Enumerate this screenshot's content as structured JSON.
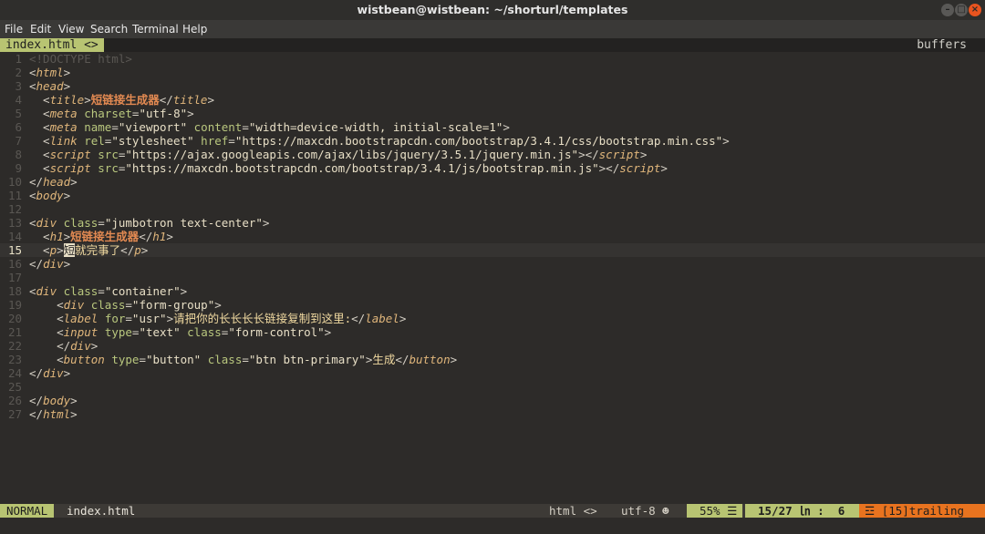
{
  "window": {
    "title": "wistbean@wistbean: ~/shorturl/templates"
  },
  "menu": [
    "File",
    "Edit",
    "View",
    "Search",
    "Terminal",
    "Help"
  ],
  "tabline": {
    "active_tab": "index.html",
    "active_tab_icon": "<>",
    "buffers_label": "buffers"
  },
  "editor": {
    "current_line": 15,
    "lines": [
      [
        [
          "c",
          "<!DOCTYPE html>"
        ]
      ],
      [
        [
          "b",
          "<"
        ],
        [
          "tag",
          "html"
        ],
        [
          "b",
          ">"
        ]
      ],
      [
        [
          "b",
          "<"
        ],
        [
          "tag",
          "head"
        ],
        [
          "b",
          ">"
        ]
      ],
      [
        [
          "b",
          "  <"
        ],
        [
          "tag",
          "title"
        ],
        [
          "b",
          ">"
        ],
        [
          "bold",
          "短链接生成器"
        ],
        [
          "b",
          "</"
        ],
        [
          "tag",
          "title"
        ],
        [
          "b",
          ">"
        ]
      ],
      [
        [
          "b",
          "  <"
        ],
        [
          "tag",
          "meta"
        ],
        [
          "b",
          " "
        ],
        [
          "attr",
          "charset"
        ],
        [
          "b",
          "="
        ],
        [
          "str",
          "\"utf-8\""
        ],
        [
          "b",
          ">"
        ]
      ],
      [
        [
          "b",
          "  <"
        ],
        [
          "tag",
          "meta"
        ],
        [
          "b",
          " "
        ],
        [
          "attr",
          "name"
        ],
        [
          "b",
          "="
        ],
        [
          "str",
          "\"viewport\""
        ],
        [
          "b",
          " "
        ],
        [
          "attr",
          "content"
        ],
        [
          "b",
          "="
        ],
        [
          "str",
          "\"width=device-width, initial-scale=1\""
        ],
        [
          "b",
          ">"
        ]
      ],
      [
        [
          "b",
          "  <"
        ],
        [
          "tag",
          "link"
        ],
        [
          "b",
          " "
        ],
        [
          "attr",
          "rel"
        ],
        [
          "b",
          "="
        ],
        [
          "str",
          "\"stylesheet\""
        ],
        [
          "b",
          " "
        ],
        [
          "attr",
          "href"
        ],
        [
          "b",
          "="
        ],
        [
          "str",
          "\"https://maxcdn.bootstrapcdn.com/bootstrap/3.4.1/css/bootstrap.min.css\""
        ],
        [
          "b",
          ">"
        ]
      ],
      [
        [
          "b",
          "  <"
        ],
        [
          "tag",
          "script"
        ],
        [
          "b",
          " "
        ],
        [
          "attr",
          "src"
        ],
        [
          "b",
          "="
        ],
        [
          "str",
          "\"https://ajax.googleapis.com/ajax/libs/jquery/3.5.1/jquery.min.js\""
        ],
        [
          "b",
          "></"
        ],
        [
          "tag",
          "script"
        ],
        [
          "b",
          ">"
        ]
      ],
      [
        [
          "b",
          "  <"
        ],
        [
          "tag",
          "script"
        ],
        [
          "b",
          " "
        ],
        [
          "attr",
          "src"
        ],
        [
          "b",
          "="
        ],
        [
          "str",
          "\"https://maxcdn.bootstrapcdn.com/bootstrap/3.4.1/js/bootstrap.min.js\""
        ],
        [
          "b",
          "></"
        ],
        [
          "tag",
          "script"
        ],
        [
          "b",
          ">"
        ]
      ],
      [
        [
          "b",
          "</"
        ],
        [
          "tag",
          "head"
        ],
        [
          "b",
          ">"
        ]
      ],
      [
        [
          "b",
          "<"
        ],
        [
          "tag",
          "body"
        ],
        [
          "b",
          ">"
        ]
      ],
      [],
      [
        [
          "b",
          "<"
        ],
        [
          "tag",
          "div"
        ],
        [
          "b",
          " "
        ],
        [
          "attr",
          "class"
        ],
        [
          "b",
          "="
        ],
        [
          "str",
          "\"jumbotron text-center\""
        ],
        [
          "b",
          ">"
        ]
      ],
      [
        [
          "b",
          "  <"
        ],
        [
          "tag",
          "h1"
        ],
        [
          "b",
          ">"
        ],
        [
          "bold",
          "短链接生成器"
        ],
        [
          "b",
          "</"
        ],
        [
          "tag",
          "h1"
        ],
        [
          "b",
          ">"
        ]
      ],
      [
        [
          "b",
          "  <"
        ],
        [
          "tag",
          "p"
        ],
        [
          "b",
          ">"
        ],
        [
          "cursor",
          "短"
        ],
        [
          "txt",
          "就完事了"
        ],
        [
          "b",
          "</"
        ],
        [
          "tag",
          "p"
        ],
        [
          "b",
          ">"
        ]
      ],
      [
        [
          "b",
          "</"
        ],
        [
          "tag",
          "div"
        ],
        [
          "b",
          ">"
        ]
      ],
      [],
      [
        [
          "b",
          "<"
        ],
        [
          "tag",
          "div"
        ],
        [
          "b",
          " "
        ],
        [
          "attr",
          "class"
        ],
        [
          "b",
          "="
        ],
        [
          "str",
          "\"container\""
        ],
        [
          "b",
          ">"
        ]
      ],
      [
        [
          "b",
          "    <"
        ],
        [
          "tag",
          "div"
        ],
        [
          "b",
          " "
        ],
        [
          "attr",
          "class"
        ],
        [
          "b",
          "="
        ],
        [
          "str",
          "\"form-group\""
        ],
        [
          "b",
          ">"
        ]
      ],
      [
        [
          "b",
          "    <"
        ],
        [
          "tag",
          "label"
        ],
        [
          "b",
          " "
        ],
        [
          "attr",
          "for"
        ],
        [
          "b",
          "="
        ],
        [
          "str",
          "\"usr\""
        ],
        [
          "b",
          ">"
        ],
        [
          "txt",
          "请把你的长长长长链接复制到这里:"
        ],
        [
          "b",
          "</"
        ],
        [
          "tag",
          "label"
        ],
        [
          "b",
          ">"
        ]
      ],
      [
        [
          "b",
          "    <"
        ],
        [
          "tag",
          "input"
        ],
        [
          "b",
          " "
        ],
        [
          "attr",
          "type"
        ],
        [
          "b",
          "="
        ],
        [
          "str",
          "\"text\""
        ],
        [
          "b",
          " "
        ],
        [
          "attr",
          "class"
        ],
        [
          "b",
          "="
        ],
        [
          "str",
          "\"form-control\""
        ],
        [
          "b",
          ">"
        ]
      ],
      [
        [
          "b",
          "    </"
        ],
        [
          "tag",
          "div"
        ],
        [
          "b",
          ">"
        ]
      ],
      [
        [
          "b",
          "    <"
        ],
        [
          "tag",
          "button"
        ],
        [
          "b",
          " "
        ],
        [
          "attr",
          "type"
        ],
        [
          "b",
          "="
        ],
        [
          "str",
          "\"button\""
        ],
        [
          "b",
          " "
        ],
        [
          "attr",
          "class"
        ],
        [
          "b",
          "="
        ],
        [
          "str",
          "\"btn btn-primary\""
        ],
        [
          "b",
          ">"
        ],
        [
          "txt",
          "生成"
        ],
        [
          "b",
          "</"
        ],
        [
          "tag",
          "button"
        ],
        [
          "b",
          ">"
        ]
      ],
      [
        [
          "b",
          "</"
        ],
        [
          "tag",
          "div"
        ],
        [
          "b",
          ">"
        ]
      ],
      [],
      [
        [
          "b",
          "</"
        ],
        [
          "tag",
          "body"
        ],
        [
          "b",
          ">"
        ]
      ],
      [
        [
          "b",
          "</"
        ],
        [
          "tag",
          "html"
        ],
        [
          "b",
          ">"
        ]
      ]
    ]
  },
  "statusline": {
    "mode": "NORMAL",
    "filename": "index.html",
    "filetype": "html <>",
    "encoding": "utf-8 ☻",
    "percent": "55% ☰",
    "position": "15/27 ㏑ :  6",
    "warning": "☲ [15]trailing",
    "colors": {
      "mode_bg": "#b8c472",
      "percent_bg": "#b8c472",
      "warning_bg": "#e8731f"
    }
  }
}
